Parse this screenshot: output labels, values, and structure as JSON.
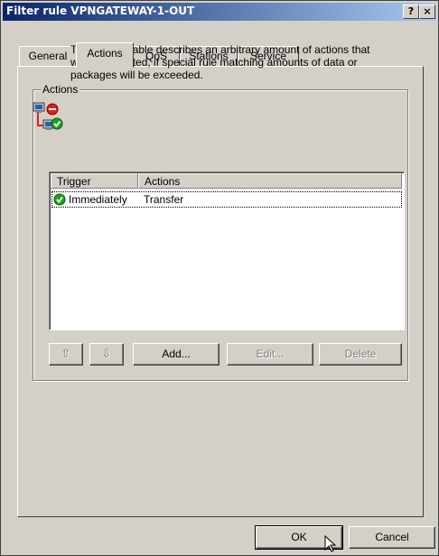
{
  "window": {
    "title": "Filter rule VPNGATEWAY-1-OUT",
    "help_label": "?",
    "close_label": "×"
  },
  "tabs": [
    {
      "label": "General",
      "active": false
    },
    {
      "label": "Actions",
      "active": true
    },
    {
      "label": "QoS",
      "active": false
    },
    {
      "label": "Stations",
      "active": false
    },
    {
      "label": "Service",
      "active": false
    }
  ],
  "actions_group": {
    "label": "Actions",
    "description": "The actions table describes an arbitrary amount of actions that will be executed, if special rule matching amounts of data or packages will be exceeded.",
    "icon": "network-computers-icon"
  },
  "table": {
    "columns": [
      "Trigger",
      "Actions"
    ],
    "rows": [
      {
        "status_icon": "green-check-icon",
        "trigger": "Immediately",
        "action": "Transfer"
      }
    ]
  },
  "toolbar": {
    "up_icon": "arrow-up-icon",
    "down_icon": "arrow-down-icon",
    "up_glyph": "⇧",
    "down_glyph": "⇩",
    "add_label": "Add...",
    "edit_label": "Edit...",
    "delete_label": "Delete"
  },
  "dialog_buttons": {
    "ok_label": "OK",
    "cancel_label": "Cancel"
  },
  "colors": {
    "titlebar_start": "#0a246a",
    "titlebar_end": "#a6caf0",
    "face": "#d4d0c8"
  }
}
